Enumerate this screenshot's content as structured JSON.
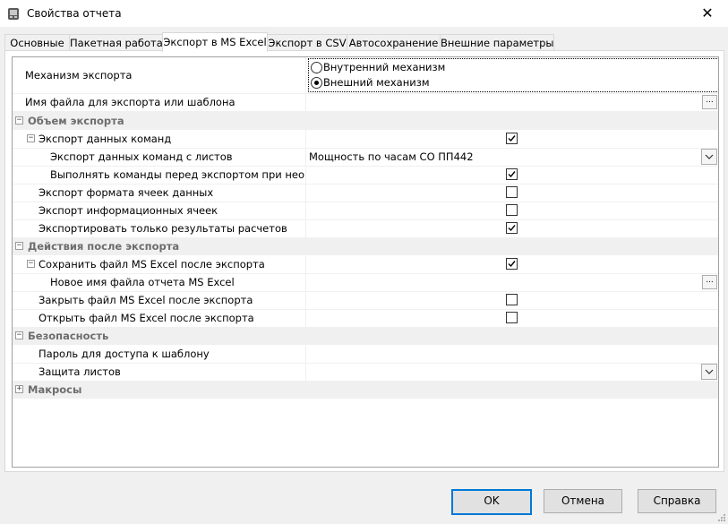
{
  "window": {
    "title": "Свойства отчета",
    "close_glyph": "✕"
  },
  "tabs": [
    {
      "label": "Основные"
    },
    {
      "label": "Пакетная работа"
    },
    {
      "label": "Экспорт в MS Excel",
      "active": true
    },
    {
      "label": "Экспорт в CSV"
    },
    {
      "label": "Автосохранение"
    },
    {
      "label": "Внешние параметры"
    }
  ],
  "props": {
    "export_mechanism": {
      "label": "Механизм экспорта",
      "option_internal": "Внутренний механизм",
      "option_external": "Внешний механизм",
      "selected": "Внешний механизм"
    },
    "file_name": {
      "label": "Имя файла для экспорта или шаблона",
      "value": "",
      "button": "..."
    },
    "cat_volume": {
      "label": "Объем экспорта",
      "expander": "−"
    },
    "export_commands": {
      "label": "Экспорт данных команд",
      "expander": "−",
      "checked": true
    },
    "export_sheets": {
      "label": "Экспорт данных команд с листов",
      "value": "Мощность по часам СО ПП442"
    },
    "run_commands": {
      "label": "Выполнять команды перед экспортом при необхо,",
      "checked": true
    },
    "export_format": {
      "label": "Экспорт формата ячеек данных",
      "checked": false
    },
    "export_info": {
      "label": "Экспорт информационных ячеек",
      "checked": false
    },
    "export_results": {
      "label": "Экспортировать только результаты расчетов",
      "checked": true
    },
    "cat_actions": {
      "label": "Действия после экспорта",
      "expander": "−"
    },
    "save_file": {
      "label": "Сохранить файл MS Excel после экспорта",
      "expander": "−",
      "checked": true
    },
    "new_file_name": {
      "label": "Новое имя файла отчета MS Excel",
      "value": "",
      "button": "..."
    },
    "close_file": {
      "label": "Закрыть файл MS Excel после экспорта",
      "checked": false
    },
    "open_file": {
      "label": "Открыть файл MS Excel после экспорта",
      "checked": false
    },
    "cat_security": {
      "label": "Безопасность",
      "expander": "−"
    },
    "template_password": {
      "label": "Пароль для доступа к шаблону",
      "value": ""
    },
    "sheet_protection": {
      "label": "Защита листов",
      "value": ""
    },
    "cat_macros": {
      "label": "Макросы",
      "expander": "+"
    }
  },
  "buttons": {
    "ok": "OK",
    "cancel": "Отмена",
    "help": "Справка"
  },
  "colors": {
    "accent": "#0078d7",
    "category_bg": "#f0f0f0",
    "category_text": "#6d6d6d"
  }
}
